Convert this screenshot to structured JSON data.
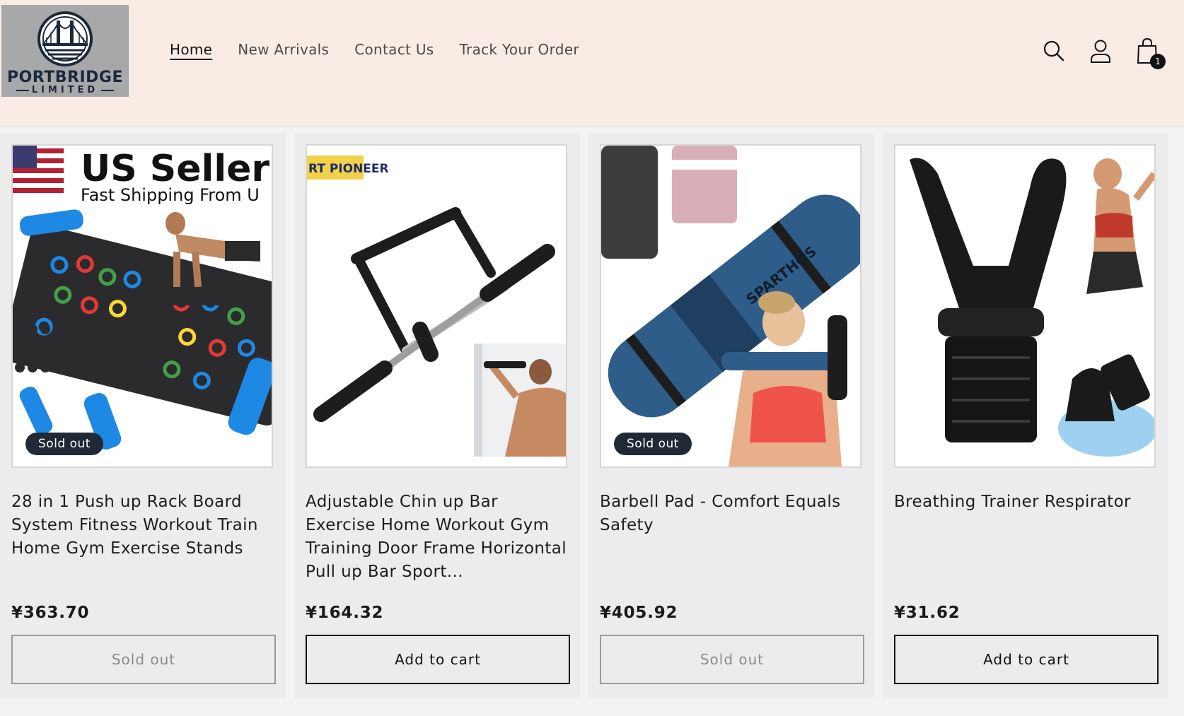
{
  "header": {
    "logo": {
      "name": "PORTBRIDGE",
      "sub": "LIMITED"
    },
    "nav": [
      "Home",
      "New Arrivals",
      "Contact Us",
      "Track Your Order"
    ],
    "cart_count": "1",
    "icons": [
      "search-icon",
      "account-icon",
      "cart-icon"
    ]
  },
  "products": [
    {
      "title": "28 in 1 Push up Rack Board System Fitness Workout Train Home Gym Exercise Stands",
      "price": "¥363.70",
      "badge": "Sold out",
      "button": "Sold out",
      "image_text": {
        "headline": "US Seller",
        "sub": "Fast Shipping From U"
      }
    },
    {
      "title": "Adjustable Chin up Bar Exercise Home Workout Gym Training Door Frame Horizontal Pull up Bar Sport...",
      "price": "¥164.32",
      "button": "Add to cart",
      "image_text": {
        "brand": "RT PIONEER"
      }
    },
    {
      "title": "Barbell Pad - Comfort Equals Safety",
      "price": "¥405.92",
      "badge": "Sold out",
      "button": "Sold out",
      "image_text": {
        "brand": "SPARTHOS"
      }
    },
    {
      "title": "Breathing Trainer Respirator",
      "price": "¥31.62",
      "button": "Add to cart"
    }
  ],
  "colors": {
    "header_bg": "#f9ece4",
    "card_bg": "#ececec",
    "badge_bg": "#1f2a36"
  }
}
